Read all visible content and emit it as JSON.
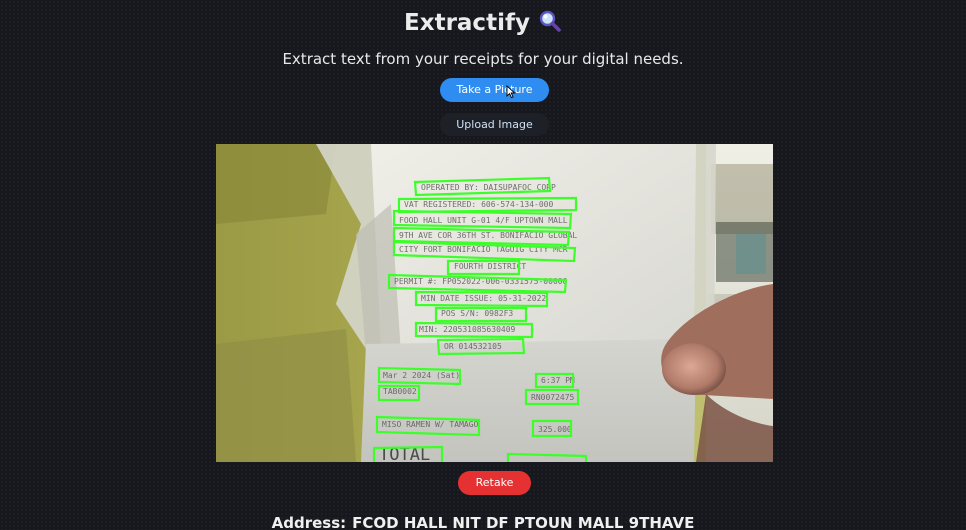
{
  "app": {
    "title": "Extractify",
    "title_icon": "magnifying-glass-icon",
    "subtitle": "Extract text from your receipts for your digital needs."
  },
  "actions": {
    "take_picture_label": "Take a Picture",
    "upload_image_label": "Upload Image",
    "retake_label": "Retake"
  },
  "colors": {
    "primary": "#2f8df1",
    "danger": "#e53131",
    "detection_box": "#3cff2a",
    "background": "#16181d"
  },
  "camera": {
    "detected_lines": [
      "OPERATED BY: DAISUPAFOC CORP",
      "VAT REGISTERED: 606-574-134-000",
      "FOOD HALL UNIT G-01 4/F UPTOWN MALL",
      "9TH AVE COR 36TH ST. BONIFACIO GLOBAL",
      "CITY FORT BONIFACIO TAGUIG CITY MCR",
      "FOURTH DISTRICT",
      "PERMIT #: FP052022-006-0331575-00000",
      "MIN DATE ISSUE: 05-31-2022",
      "POS S/N: 0982F3",
      "MIN: 220531085630409",
      "OR 014532105",
      "Mar 2 2024 (Sat)",
      "6:37 PM",
      "TAB0002",
      "RN0072475",
      "MISO RAMEN W/ TAMAGO",
      "325.000",
      "TOTAL"
    ]
  },
  "result": {
    "address_label": "Address:",
    "address_value": "FCOD HALL NIT DF PTOUN MALL 9THAVE"
  }
}
